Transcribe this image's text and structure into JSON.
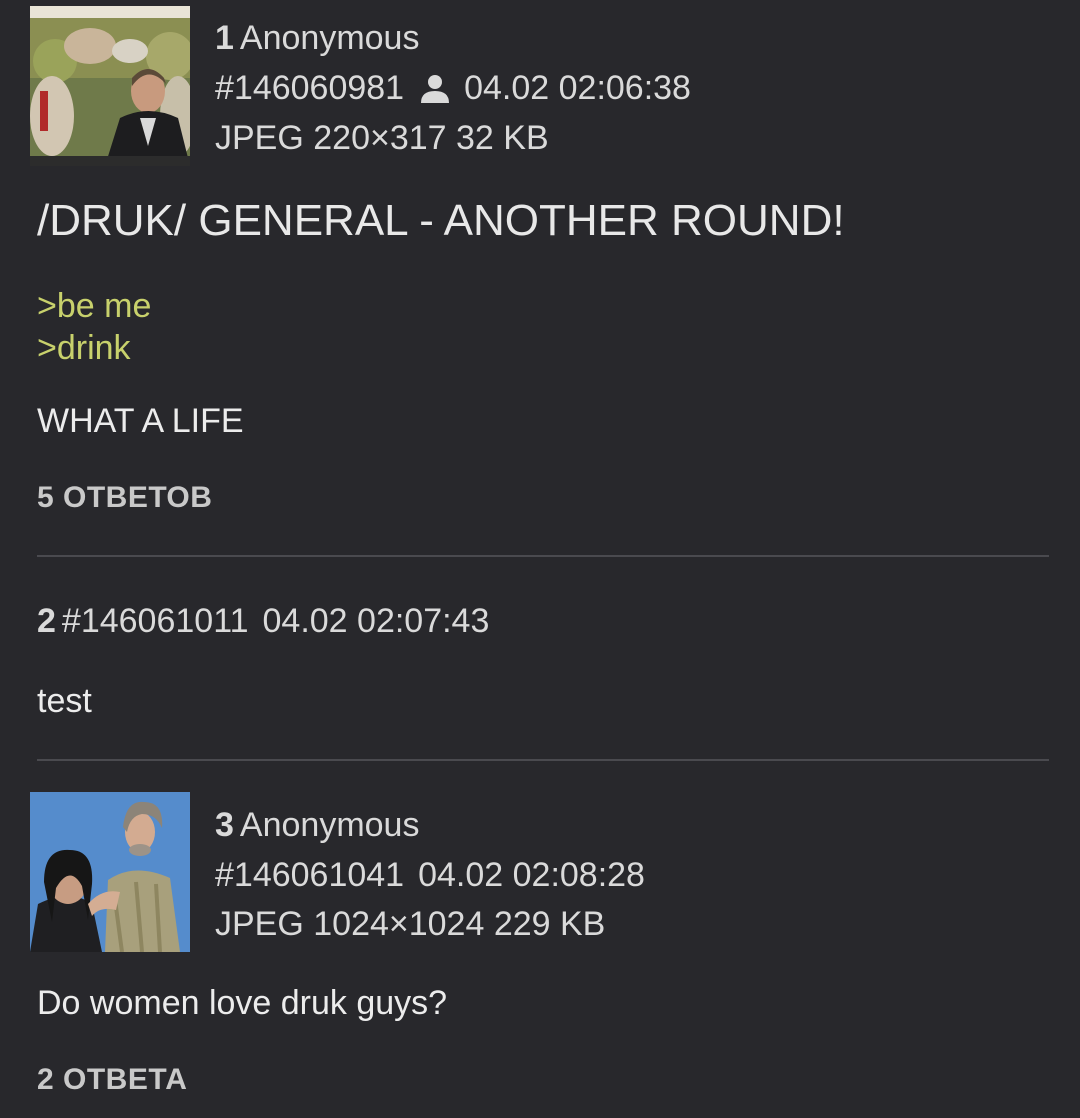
{
  "posts": [
    {
      "number": "1",
      "author": "Anonymous",
      "post_id": "#146060981",
      "user_icon": "person-icon",
      "datetime": "04.02 02:06:38",
      "file_info": "JPEG 220×317 32 KB",
      "subject": "/DRUK/ GENERAL - ANOTHER ROUND!",
      "greentext": [
        ">be me",
        ">drink"
      ],
      "text": "WHAT A LIFE",
      "replies": "5 ОТВЕТОВ"
    },
    {
      "number": "2",
      "post_id": "#146061011",
      "datetime": "04.02 02:07:43",
      "text": "test"
    },
    {
      "number": "3",
      "author": "Anonymous",
      "post_id": "#146061041",
      "datetime": "04.02 02:08:28",
      "file_info": "JPEG 1024×1024 229 KB",
      "text": "Do women love druk guys?",
      "replies": "2 ОТВЕТА"
    }
  ],
  "colors": {
    "background": "#28282c",
    "greentext": "#c8d16c",
    "divider": "#4a4a4f"
  }
}
